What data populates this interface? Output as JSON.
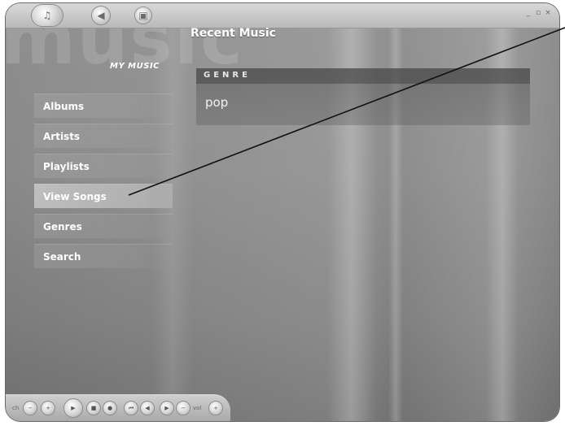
{
  "header": {
    "title": "Recent Music",
    "section_label": "MY MUSIC"
  },
  "watermark_text": "music",
  "nav": {
    "items": [
      {
        "label": "Albums",
        "active": false
      },
      {
        "label": "Artists",
        "active": false
      },
      {
        "label": "Playlists",
        "active": false
      },
      {
        "label": "View Songs",
        "active": true
      },
      {
        "label": "Genres",
        "active": false
      },
      {
        "label": "Search",
        "active": false
      }
    ]
  },
  "genre": {
    "header": "GENRE",
    "value": "pop"
  },
  "window_controls": {
    "minimize": "_",
    "maximize": "▫",
    "close": "×"
  },
  "transport": {
    "left_label": "ch",
    "right_label": "vol"
  },
  "icons": {
    "start_orb": "windows-logo-icon",
    "back": "back-icon",
    "media": "media-icon"
  }
}
